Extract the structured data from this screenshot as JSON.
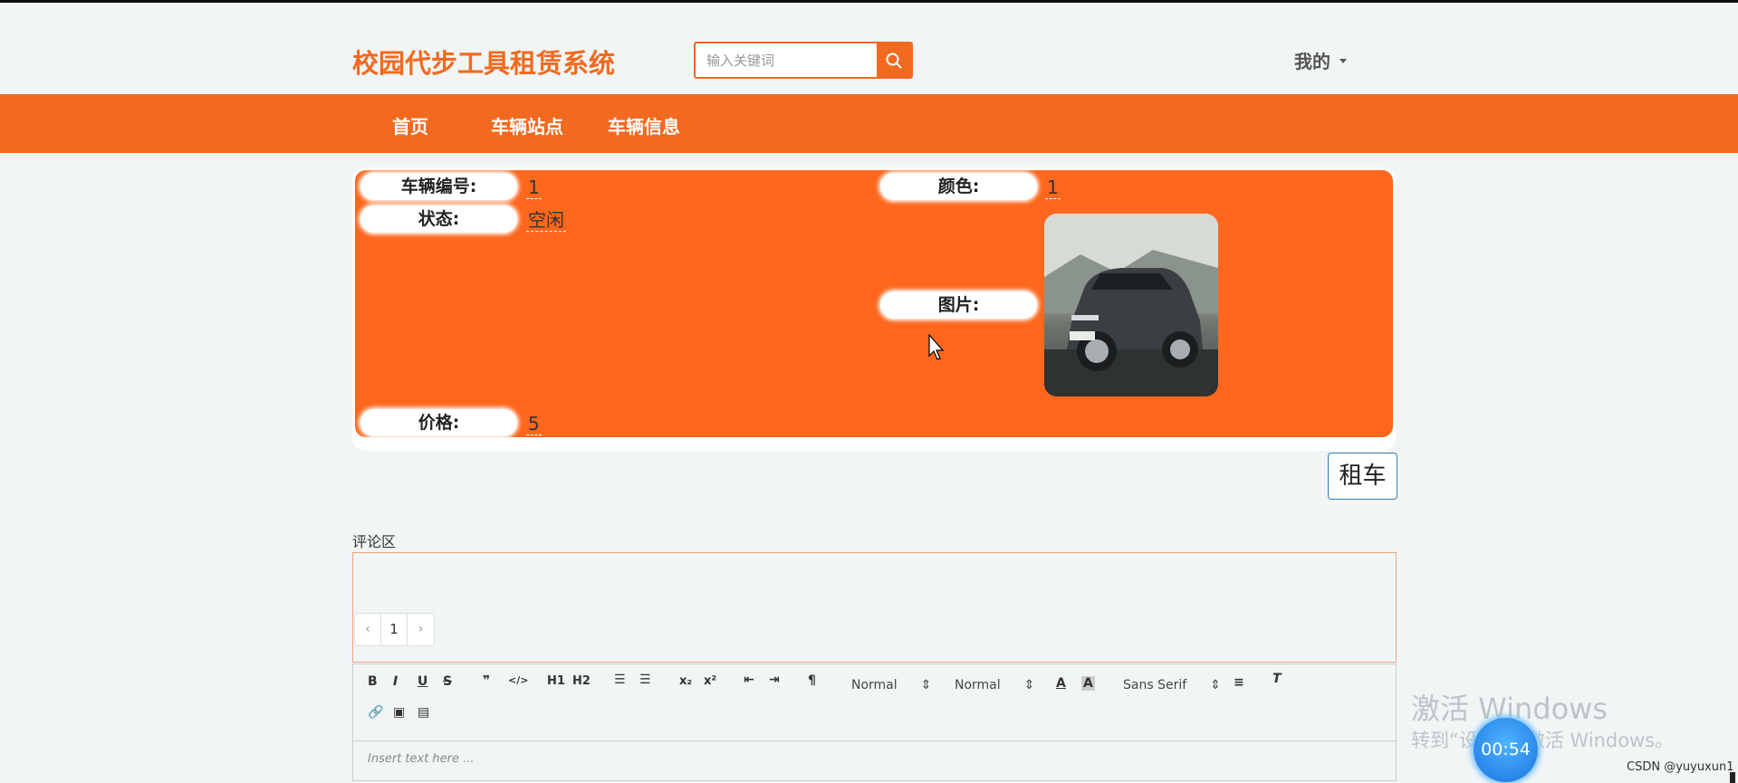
{
  "header": {
    "logo": "校园代步工具租赁系统",
    "search_placeholder": "输入关键词",
    "user_menu": "我的"
  },
  "nav": {
    "items": [
      "首页",
      "车辆站点",
      "车辆信息"
    ]
  },
  "vehicle": {
    "fields": {
      "number_label": "车辆编号:",
      "number_value": "1",
      "status_label": "状态:",
      "status_value": "空闲",
      "price_label": "价格:",
      "price_value": "5",
      "color_label": "颜色:",
      "color_value": "1",
      "image_label": "图片:"
    }
  },
  "actions": {
    "rent_button": "租车"
  },
  "comments": {
    "label": "评论区",
    "pagination": {
      "prev": "‹",
      "current": "1",
      "next": "›"
    }
  },
  "editor": {
    "toolbar": {
      "size_select": "Normal",
      "header_select": "Normal",
      "font_select": "Sans Serif"
    },
    "placeholder": "Insert text here ..."
  },
  "overlay": {
    "windows_watermark_line1": "激活 Windows",
    "windows_watermark_line2": "转到“设置”以激活 Windows。",
    "timer": "00:54",
    "csdn_credit": "CSDN @yuyuxun1"
  },
  "colors": {
    "brand": "#f26a1f",
    "card": "#ff671d"
  }
}
